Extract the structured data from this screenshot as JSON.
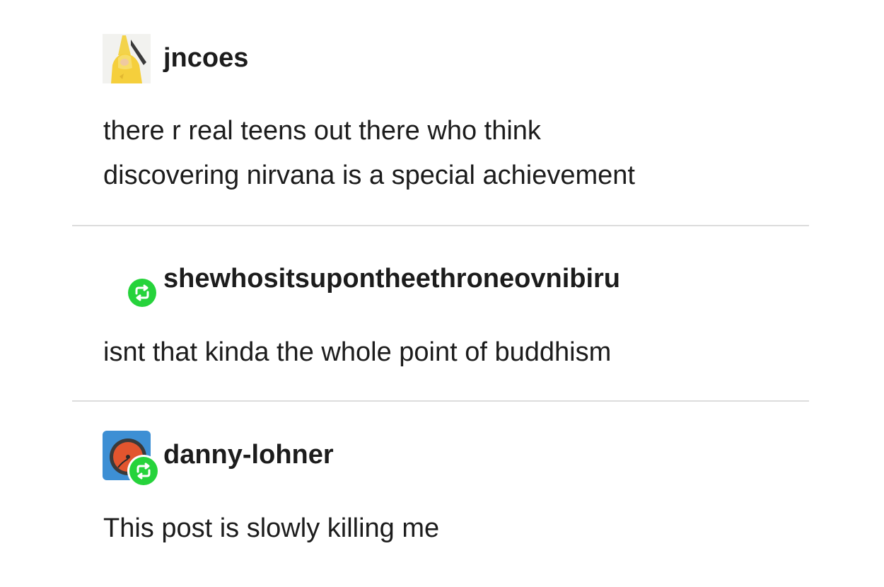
{
  "posts": [
    {
      "username": "jncoes",
      "text_lines": [
        "there r real teens out there who think",
        "discovering nirvana is a special achievement"
      ]
    },
    {
      "username": "shewhositsupontheethroneovnibiru",
      "text_lines": [
        "isnt that kinda the whole point of buddhism"
      ]
    },
    {
      "username": "danny-lohner",
      "text_lines": [
        "This post is slowly killing me"
      ]
    }
  ],
  "icons": {
    "reblog": "reblog-icon",
    "avatar_jncoes": "avatar-yellow-raincoat",
    "avatar_danny": "avatar-vinyl-record"
  },
  "colors": {
    "reblog_green": "#26d33b",
    "divider": "#dcdcdc",
    "text": "#1c1c1c"
  }
}
